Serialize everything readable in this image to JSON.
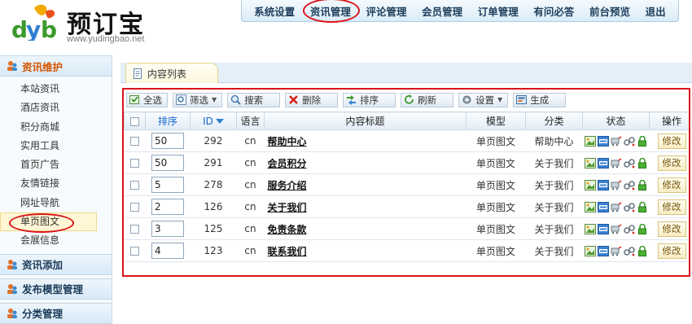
{
  "logo": {
    "mark": "dyb",
    "title": "预订宝",
    "url": "www.yudingbao.net"
  },
  "topnav": {
    "items": [
      "系统设置",
      "资讯管理",
      "评论管理",
      "会员管理",
      "订单管理",
      "有问必答",
      "前台预览",
      "退出"
    ],
    "active": "资讯管理"
  },
  "sidebar": {
    "sections": [
      {
        "label": "资讯维护",
        "open": true
      },
      {
        "label": "资讯添加"
      },
      {
        "label": "发布模型管理"
      },
      {
        "label": "分类管理"
      }
    ],
    "items": [
      "本站资讯",
      "酒店资讯",
      "积分商城",
      "实用工具",
      "首页广告",
      "友情链接",
      "网址导航",
      "单页图文",
      "会展信息"
    ],
    "active_item": "单页图文"
  },
  "tab": {
    "label": "内容列表"
  },
  "toolbar": {
    "select_all": "全选",
    "filter": "筛选",
    "search": "搜索",
    "delete": "删除",
    "sort": "排序",
    "refresh": "刷新",
    "settings": "设置",
    "generate": "生成"
  },
  "table": {
    "headers": {
      "order": "排序",
      "id": "ID",
      "lang": "语言",
      "title": "内容标题",
      "model": "模型",
      "category": "分类",
      "status": "状态",
      "action": "操作"
    },
    "rows": [
      {
        "order": "50",
        "id": "292",
        "lang": "cn",
        "title": "帮助中心",
        "model": "单页图文",
        "category": "帮助中心",
        "action": "修改"
      },
      {
        "order": "50",
        "id": "291",
        "lang": "cn",
        "title": "会员积分",
        "model": "单页图文",
        "category": "关于我们",
        "action": "修改"
      },
      {
        "order": "5",
        "id": "278",
        "lang": "cn",
        "title": "服务介绍",
        "model": "单页图文",
        "category": "关于我们",
        "action": "修改"
      },
      {
        "order": "2",
        "id": "126",
        "lang": "cn",
        "title": "关于我们",
        "model": "单页图文",
        "category": "关于我们",
        "action": "修改"
      },
      {
        "order": "3",
        "id": "125",
        "lang": "cn",
        "title": "免责条款",
        "model": "单页图文",
        "category": "关于我们",
        "action": "修改"
      },
      {
        "order": "4",
        "id": "123",
        "lang": "cn",
        "title": "联系我们",
        "model": "单页图文",
        "category": "关于我们",
        "action": "修改"
      }
    ]
  },
  "colors": {
    "highlight_ring": "#d9141b",
    "section_open": "#d45500",
    "nav_text": "#1f3f5c"
  }
}
